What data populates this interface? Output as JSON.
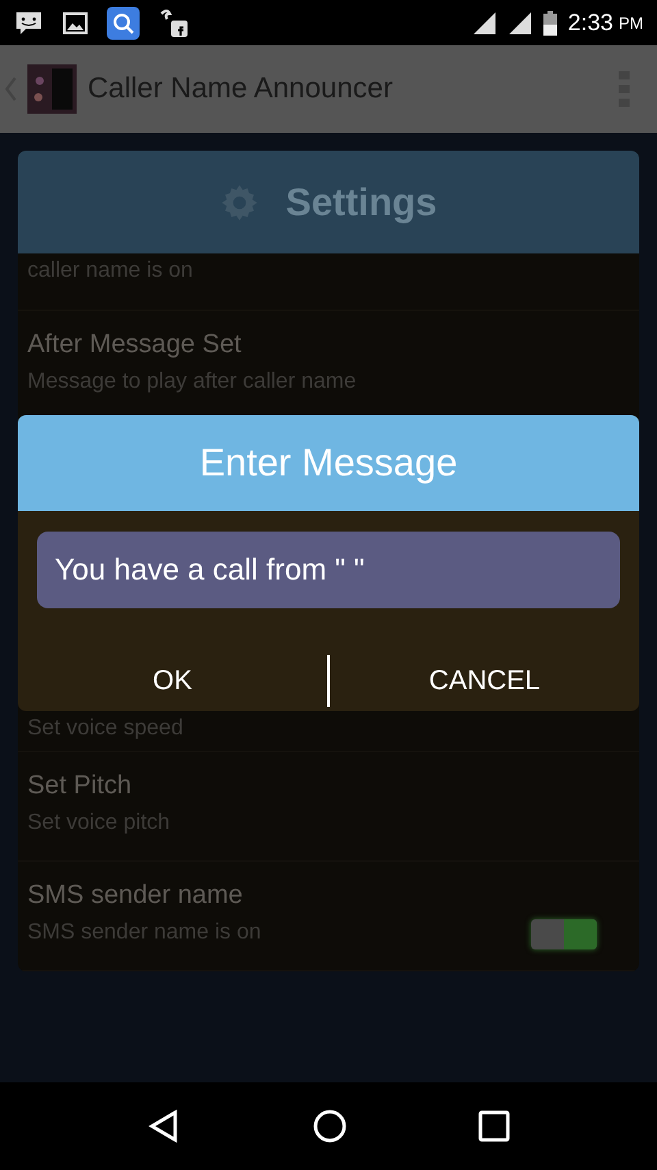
{
  "status_bar": {
    "time": "2:33",
    "ampm": "PM"
  },
  "app_bar": {
    "title": "Caller Name Announcer"
  },
  "settings": {
    "title": "Settings",
    "rows_above": [
      {
        "subtitle": "caller name is on"
      },
      {
        "title": "After Message Set",
        "subtitle": "Message to play after caller name"
      }
    ],
    "rows_below": [
      {
        "subtitle": "Set voice speed"
      },
      {
        "title": "Set Pitch",
        "subtitle": "Set voice pitch"
      },
      {
        "title": "SMS sender name",
        "subtitle": "SMS sender name is on",
        "toggle": {
          "on": true
        }
      }
    ]
  },
  "dialog": {
    "title": "Enter Message",
    "value": "You have a call from \" \"",
    "buttons": [
      "OK",
      "CANCEL"
    ]
  }
}
